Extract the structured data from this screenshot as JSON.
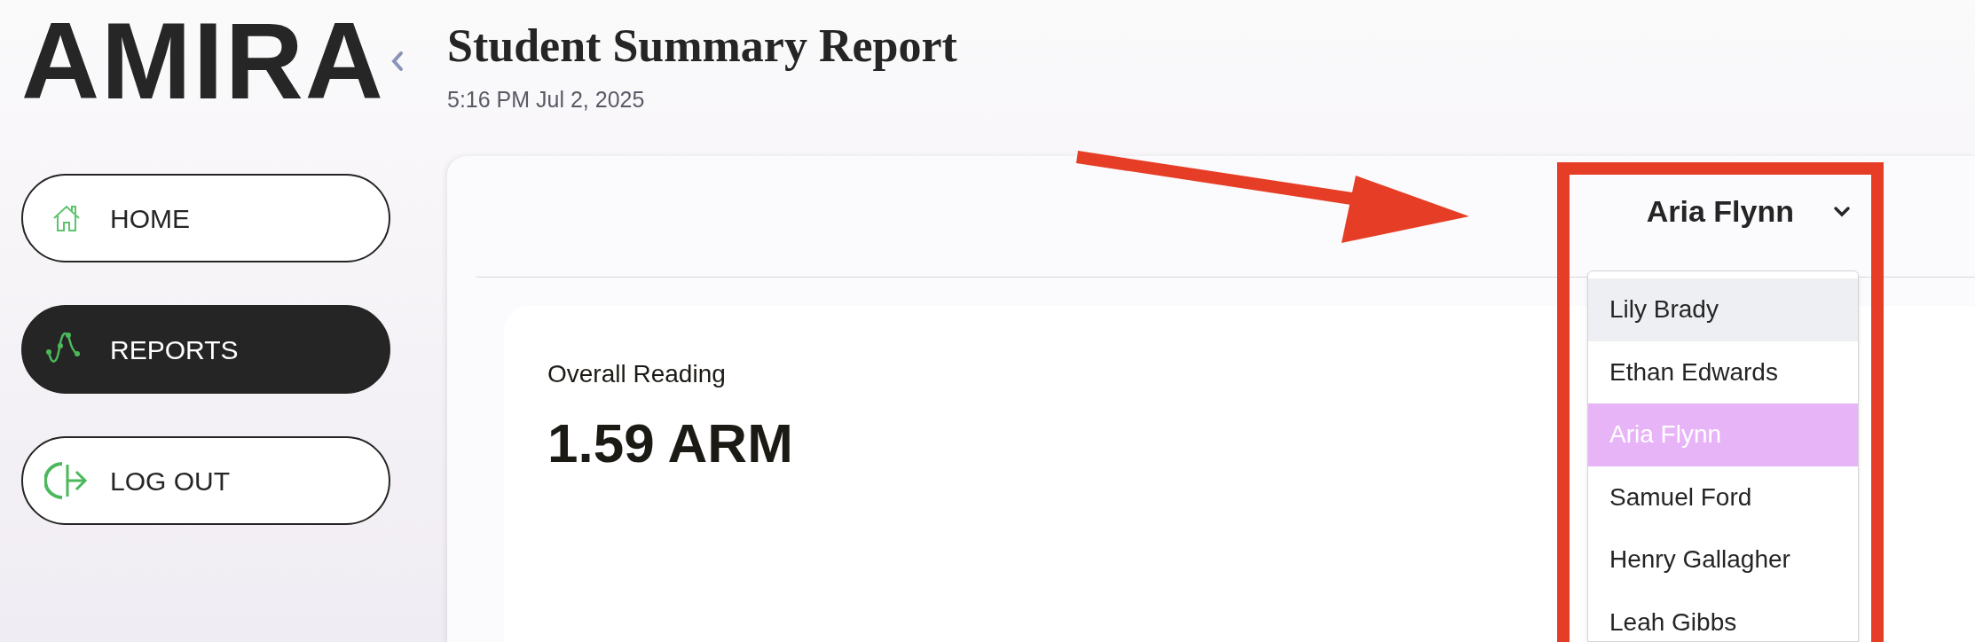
{
  "logo": "AMIRA",
  "sidebar": {
    "items": [
      {
        "label": "HOME",
        "selected": false
      },
      {
        "label": "REPORTS",
        "selected": true
      },
      {
        "label": "LOG OUT",
        "selected": false
      }
    ]
  },
  "header": {
    "title": "Student Summary Report",
    "timestamp": "5:16 PM Jul 2, 2025"
  },
  "student_select": {
    "value": "Aria Flynn",
    "expanded": true,
    "options": [
      {
        "label": "Lily Brady",
        "selected": false,
        "hovered": true
      },
      {
        "label": "Ethan Edwards",
        "selected": false,
        "hovered": false
      },
      {
        "label": "Aria Flynn",
        "selected": true,
        "hovered": false
      },
      {
        "label": "Samuel Ford",
        "selected": false,
        "hovered": false
      },
      {
        "label": "Henry Gallagher",
        "selected": false,
        "hovered": false
      },
      {
        "label": "Leah Gibbs",
        "selected": false,
        "hovered": false
      }
    ]
  },
  "overall_card": {
    "label": "Overall Reading",
    "value": "1.59 ARM"
  }
}
